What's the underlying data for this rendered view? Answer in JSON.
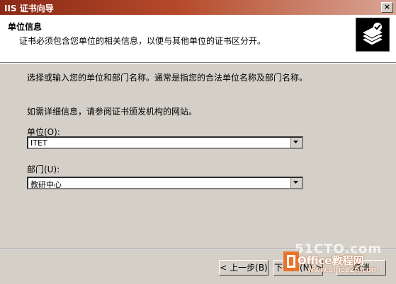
{
  "window": {
    "title": "IIS 证书向导",
    "close_glyph": "×"
  },
  "header": {
    "title": "单位信息",
    "description": "证书必须包含您单位的相关信息，以便与其他单位的证书区分开。",
    "icon": "certificate-icon"
  },
  "body": {
    "instruction": "选择或输入您的单位和部门名称。通常是指您的合法单位名称及部门名称。",
    "more_info": "如需详细信息，请参阅证书颁发机构的网站。",
    "organization": {
      "label": "单位(O):",
      "value": "ITET"
    },
    "department": {
      "label": "部门(U):",
      "value": "教研中心"
    }
  },
  "buttons": {
    "back": "< 上一步(B)",
    "next": "下一步(N) >",
    "cancel": "取消"
  },
  "watermark": {
    "site_text": "51CTO.com",
    "brand": "Office教程网",
    "url": "www.office26.com"
  }
}
